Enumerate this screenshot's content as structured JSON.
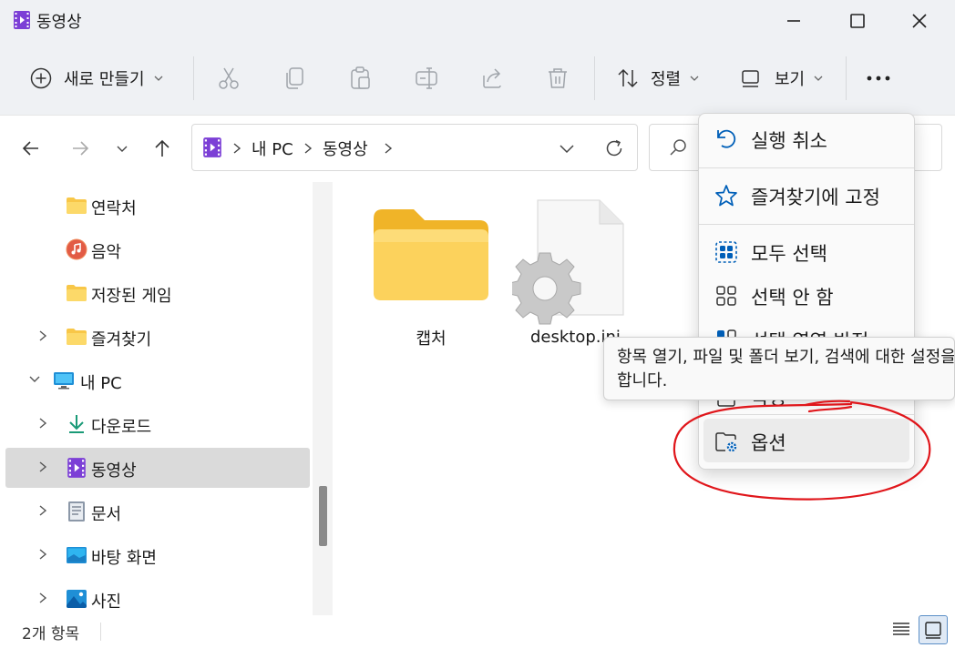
{
  "window": {
    "title": "동영상",
    "controls": {
      "minimize": "minimize-icon",
      "maximize": "maximize-icon",
      "close": "close-icon"
    }
  },
  "toolbar": {
    "new_label": "새로 만들기",
    "sort_label": "정렬",
    "view_label": "보기",
    "icons": [
      "cut-icon",
      "copy-icon",
      "paste-icon",
      "rename-icon",
      "share-icon",
      "delete-icon",
      "more-icon"
    ]
  },
  "address": {
    "crumbs": [
      "내 PC",
      "동영상"
    ]
  },
  "sidebar": {
    "items": [
      {
        "label": "연락처"
      },
      {
        "label": "음악"
      },
      {
        "label": "저장된 게임"
      },
      {
        "label": "즐겨찾기"
      },
      {
        "label": "내 PC"
      },
      {
        "label": "다운로드"
      },
      {
        "label": "동영상"
      },
      {
        "label": "문서"
      },
      {
        "label": "바탕 화면"
      },
      {
        "label": "사진"
      }
    ]
  },
  "content": {
    "items": [
      {
        "name": "캡처",
        "icon": "folder-icon"
      },
      {
        "name": "desktop.ini",
        "icon": "settings-file-icon"
      }
    ]
  },
  "menu": {
    "items": [
      {
        "label": "실행 취소"
      },
      {
        "label": "즐겨찾기에 고정"
      },
      {
        "label": "모두 선택"
      },
      {
        "label": "선택 안 함"
      },
      {
        "label": "선택 영역 반전"
      },
      {
        "label": "속성"
      },
      {
        "label": "옵션"
      }
    ]
  },
  "tooltip": {
    "line1": "항목 열기, 파일 및 폴더 보기, 검색에 대한 설정을 변경",
    "line2": "합니다."
  },
  "status": {
    "count": "2개 항목"
  },
  "colors": {
    "accent": "#005fb8",
    "folder": "#f8c748",
    "annotation": "#e0161b",
    "video": "#7c3fd6"
  }
}
